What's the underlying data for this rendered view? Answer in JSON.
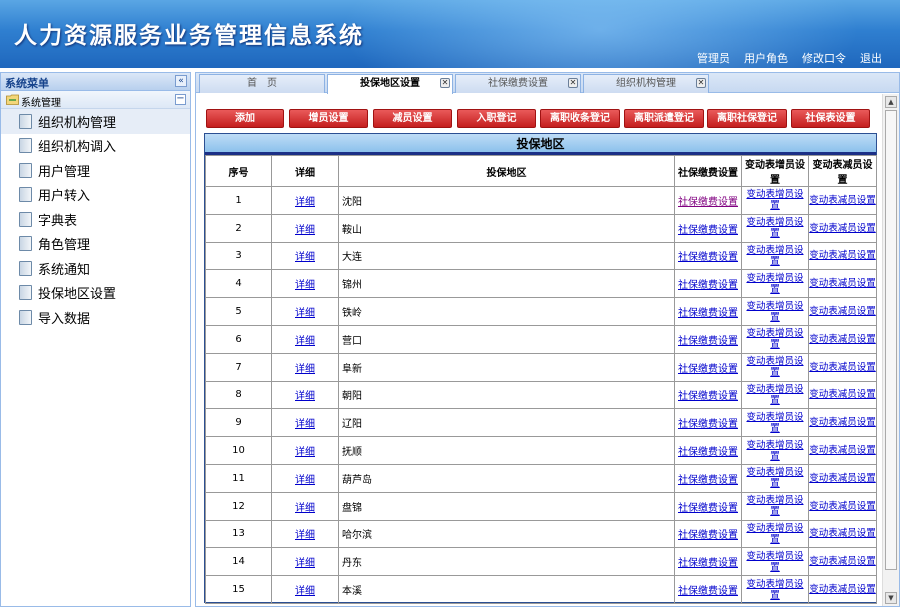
{
  "app": {
    "title": "人力资源服务业务管理信息系统",
    "toplinks": [
      "管理员",
      "用户角色",
      "修改口令",
      "退出"
    ]
  },
  "sidebar": {
    "header": "系统菜单",
    "group": "系统管理",
    "items": [
      {
        "label": "组织机构管理"
      },
      {
        "label": "组织机构调入"
      },
      {
        "label": "用户管理"
      },
      {
        "label": "用户转入"
      },
      {
        "label": "字典表"
      },
      {
        "label": "角色管理"
      },
      {
        "label": "系统通知"
      },
      {
        "label": "投保地区设置"
      },
      {
        "label": "导入数据"
      }
    ]
  },
  "tabs": [
    {
      "label": "首　页"
    },
    {
      "label": "投保地区设置"
    },
    {
      "label": "社保缴费设置"
    },
    {
      "label": "组织机构管理"
    }
  ],
  "toolbar": {
    "buttons": [
      "添加",
      "增员设置",
      "减员设置",
      "入职登记",
      "离职收条登记",
      "离职派遣登记",
      "离职社保登记",
      "社保表设置"
    ]
  },
  "panel": {
    "title": "投保地区",
    "columns": [
      "序号",
      "详细",
      "投保地区",
      "社保缴费设置",
      "变动表增员设置",
      "变动表减员设置"
    ],
    "links": {
      "detail": "详细",
      "social": "社保缴费设置",
      "increase": "变动表增员设置",
      "decrease": "变动表减员设置"
    },
    "rows": [
      {
        "no": "1",
        "area": "沈阳"
      },
      {
        "no": "2",
        "area": "鞍山"
      },
      {
        "no": "3",
        "area": "大连"
      },
      {
        "no": "4",
        "area": "锦州"
      },
      {
        "no": "5",
        "area": "铁岭"
      },
      {
        "no": "6",
        "area": "营口"
      },
      {
        "no": "7",
        "area": "阜新"
      },
      {
        "no": "8",
        "area": "朝阳"
      },
      {
        "no": "9",
        "area": "辽阳"
      },
      {
        "no": "10",
        "area": "抚顺"
      },
      {
        "no": "11",
        "area": "葫芦岛"
      },
      {
        "no": "12",
        "area": "盘锦"
      },
      {
        "no": "13",
        "area": "哈尔滨"
      },
      {
        "no": "14",
        "area": "丹东"
      },
      {
        "no": "15",
        "area": "本溪"
      }
    ]
  },
  "colors": {
    "header_blue": "#2f7fd0",
    "button_red": "#c41e1e",
    "link_blue": "#0000cc",
    "link_visited": "#800080"
  }
}
